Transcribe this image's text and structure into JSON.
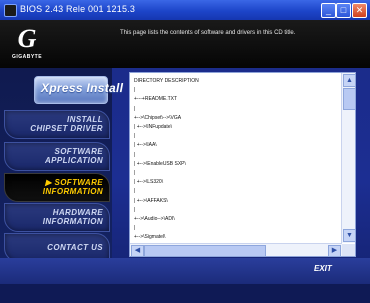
{
  "window": {
    "title": "BIOS 2.43 Rele 001 1215.3",
    "min_label": "_",
    "max_label": "□",
    "close_label": "✕"
  },
  "brand": {
    "logo_letter": "G",
    "name": "GIGABYTE"
  },
  "header": {
    "description": "This page lists the contents of software and drivers in this CD title."
  },
  "xpress": {
    "label": "Xpress Install"
  },
  "nav": [
    {
      "line1": "INSTALL",
      "line2": "CHIPSET DRIVER",
      "active": false
    },
    {
      "line1": "SOFTWARE",
      "line2": "APPLICATION",
      "active": false
    },
    {
      "line1": "SOFTWARE",
      "line2": "INFORMATION",
      "active": true,
      "marker": "▶"
    },
    {
      "line1": "HARDWARE",
      "line2": "INFORMATION",
      "active": false
    },
    {
      "line1": "CONTACT US",
      "line2": "",
      "active": false
    }
  ],
  "tree": [
    "DIRECTORY DESCRIPTION",
    "|",
    "+---+README.TXT",
    "|",
    "+-->\\Chipset\\-->\\VGA",
    "|        +-->\\INFupdate\\",
    "|",
    "|        +-->\\IAA\\",
    "|",
    "|        +-->\\EnableUSB SXP\\",
    "|",
    "|        +-->\\LS320\\",
    "|",
    "|        +-->\\AFFAKS\\",
    "|",
    "+-->\\Audio-->\\ADI\\",
    "|",
    "         +-->\\Sigmatel\\"
  ],
  "scrollbar": {
    "up": "▲",
    "down": "▼",
    "left": "◀",
    "right": "▶"
  },
  "footer": {
    "exit_label": "EXIT"
  }
}
